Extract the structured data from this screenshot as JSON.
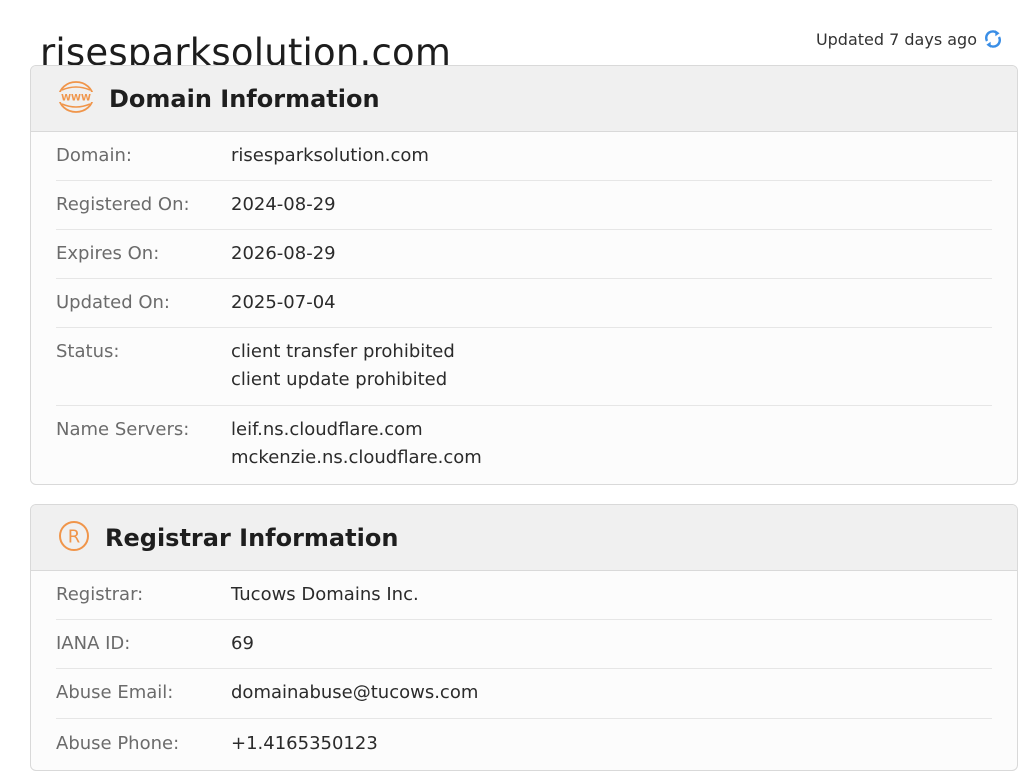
{
  "header": {
    "domain_title": "risesparksolution.com",
    "updated_text": "Updated 7 days ago",
    "refresh_icon": "refresh-icon",
    "accent_color": "#3a8ee6"
  },
  "domain_info": {
    "title": "Domain Information",
    "icon": "www-icon",
    "icon_text": "WWW",
    "icon_color": "#f0954a",
    "rows": [
      {
        "label": "Domain:",
        "values": [
          "risesparksolution.com"
        ]
      },
      {
        "label": "Registered On:",
        "values": [
          "2024-08-29"
        ]
      },
      {
        "label": "Expires On:",
        "values": [
          "2026-08-29"
        ]
      },
      {
        "label": "Updated On:",
        "values": [
          "2025-07-04"
        ]
      },
      {
        "label": "Status:",
        "values": [
          "client transfer prohibited",
          "client update prohibited"
        ]
      },
      {
        "label": "Name Servers:",
        "values": [
          "leif.ns.cloudflare.com",
          "mckenzie.ns.cloudflare.com"
        ]
      }
    ]
  },
  "registrar_info": {
    "title": "Registrar Information",
    "icon": "registered-icon",
    "icon_text": "R",
    "icon_color": "#f0954a",
    "rows": [
      {
        "label": "Registrar:",
        "values": [
          "Tucows Domains Inc."
        ]
      },
      {
        "label": "IANA ID:",
        "values": [
          "69"
        ]
      },
      {
        "label": "Abuse Email:",
        "values": [
          "domainabuse@tucows.com"
        ]
      },
      {
        "label": "Abuse Phone:",
        "values": [
          "+1.4165350123"
        ]
      }
    ]
  }
}
